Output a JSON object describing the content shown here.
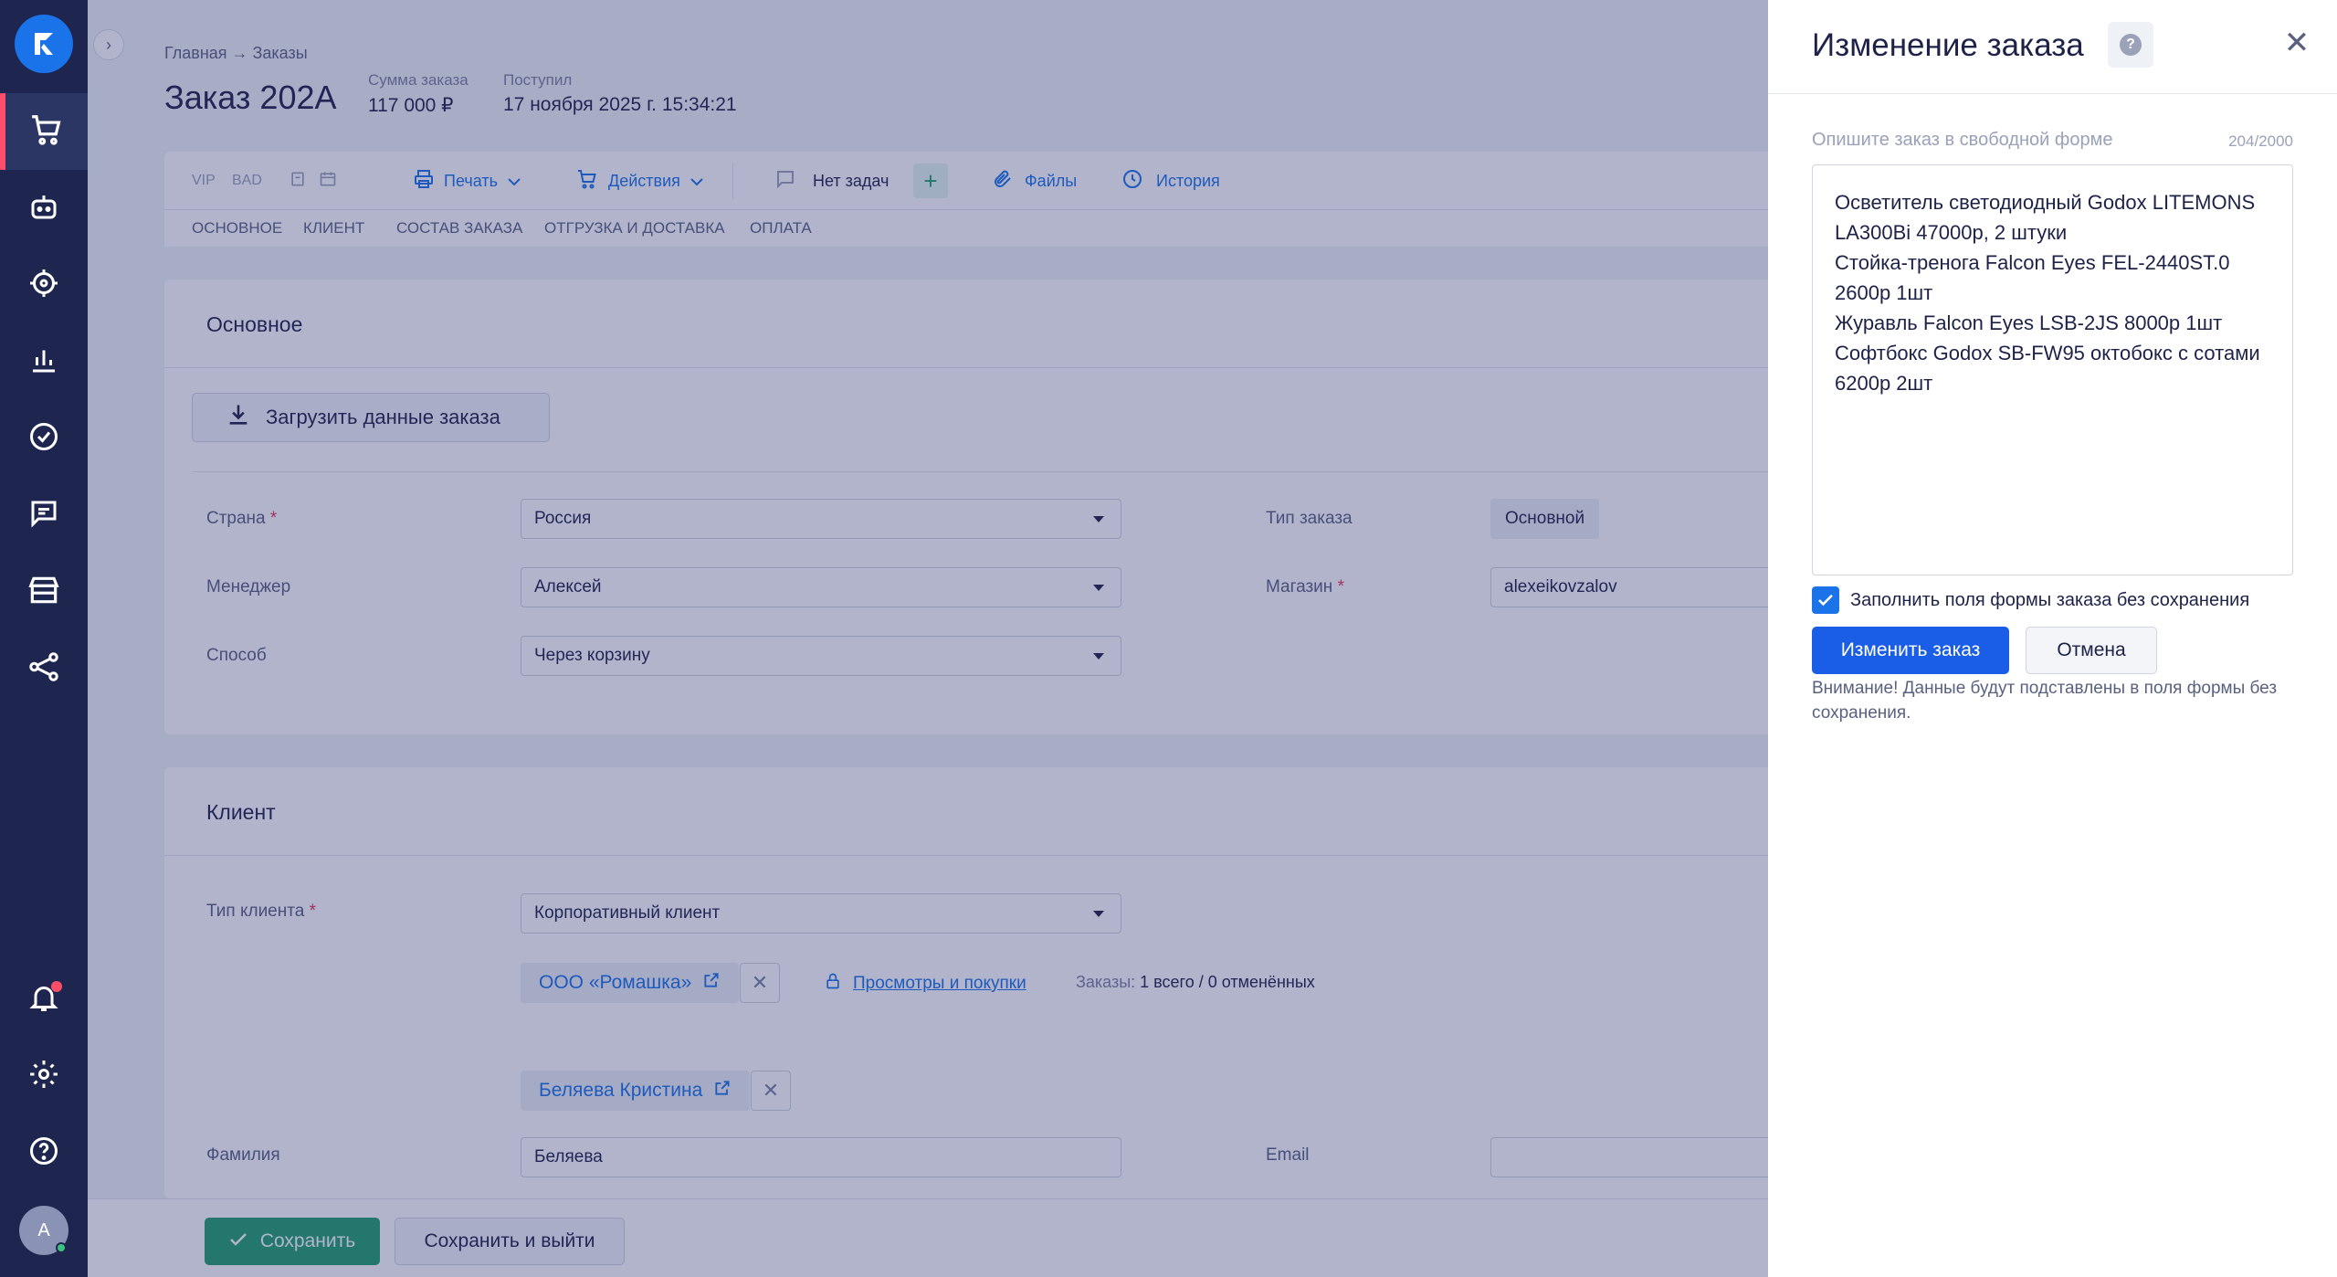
{
  "order": {
    "breadcrumb": "Главная → Заказы",
    "title": "Заказ 202А",
    "sum_label": "Сумма заказа",
    "sum_value": "117 000 ₽",
    "received_label": "Поступил",
    "received_value": "17 ноября 2025 г. 15:34:21"
  },
  "toolbar": {
    "vip": "VIP",
    "bad": "BAD",
    "print": "Печать",
    "actions": "Действия",
    "tasks": "Нет задач",
    "add": "+",
    "files": "Файлы",
    "history": "История"
  },
  "tabs": [
    {
      "label": "Основное"
    },
    {
      "label": "Клиент"
    },
    {
      "label": "Состав заказа"
    },
    {
      "label": "Отгрузка и доставка"
    },
    {
      "label": "Оплата"
    }
  ],
  "main_section": {
    "title": "Основное",
    "upload_label": "Загрузить данные заказа",
    "country_label": "Страна",
    "country_value": "Россия",
    "manager_label": "Менеджер",
    "manager_value": "Алексей",
    "method_label": "Способ",
    "method_value": "Через корзину",
    "order_type_label": "Тип заказа",
    "order_type_value": "Основной",
    "shop_label": "Магазин",
    "shop_value": "alexeikovzalov",
    "required_mark": "*"
  },
  "client_section": {
    "title": "Клиент",
    "client_type_label": "Тип клиента",
    "client_type_value": "Корпоративный клиент",
    "company": "ООО «Ромашка»",
    "views_link": "Просмотры и покупки",
    "orders_label": "Заказы:",
    "orders_value": "1 всего / 0 отменённых",
    "contact": "Беляева Кристина",
    "lastname_label": "Фамилия",
    "lastname_value": "Беляева",
    "email_label": "Email",
    "email_value": ""
  },
  "footer": {
    "save": "Сохранить",
    "save_exit": "Сохранить и выйти"
  },
  "panel": {
    "title": "Изменение заказа",
    "help": "?",
    "close": "✕",
    "desc_label": "Опишите заказ в свободной форме",
    "counter": "204/2000",
    "text": "Осветитель светодиодный Godox LITEMONS LA300Bi 47000р, 2 штуки\nСтойка-тренога Falcon Eyes FEL-2440ST.0 2600р 1шт\nЖуравль Falcon Eyes LSB-2JS 8000р 1шт\nСофтбокс Godox SB-FW95 октобокс с сотами 6200р 2шт",
    "checkbox_label": "Заполнить поля формы заказа без сохранения",
    "submit": "Изменить заказ",
    "cancel": "Отмена",
    "warning": "Внимание! Данные будут подставлены в поля формы без сохранения."
  },
  "user": {
    "avatar_letter": "A"
  },
  "colors": {
    "nav_bg": "#1e2650",
    "accent_blue": "#1a73e8",
    "save_green": "#22a06b",
    "alert_red": "#ff4d6a"
  },
  "icons": [
    "logo-icon",
    "cart-icon",
    "bot-icon",
    "target-icon",
    "chart-icon",
    "check-circle-icon",
    "chat-icon",
    "store-icon",
    "share-icon",
    "bell-icon",
    "gear-icon",
    "help-icon",
    "download-icon",
    "printer-icon",
    "cart-icon",
    "comment-icon",
    "paperclip-icon",
    "clock-icon",
    "external-link-icon",
    "lock-icon",
    "close-icon",
    "check-icon"
  ]
}
